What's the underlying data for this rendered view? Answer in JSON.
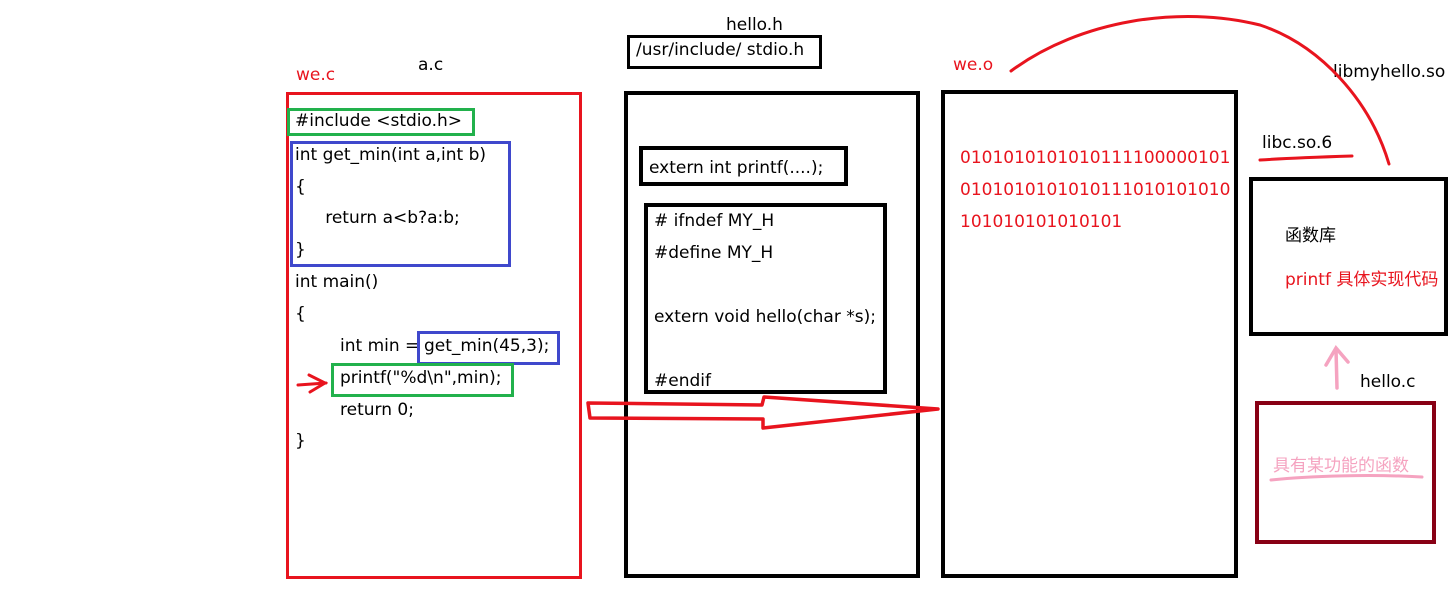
{
  "labels": {
    "we_c": "we.c",
    "a_c": "a.c",
    "hello_h": "hello.h",
    "stdio_path": "/usr/include/ stdio.h",
    "we_o": "we.o",
    "libmyhello": "libmyhello.so",
    "libc": "libc.so.6",
    "hello_c": "hello.c"
  },
  "source_code": {
    "include": "#include <stdio.h>",
    "fn_sig": "int get_min(int a,int b)",
    "fn_open": "{",
    "fn_body": "        return a<b?a:b;",
    "fn_close": "}",
    "main_sig": "int main()",
    "main_open": "{",
    "min_decl": "int min = ",
    "min_call": "get_min(45,3);",
    "printf_line": "printf(\"%d\\n\",min);",
    "return_line": "return 0;",
    "main_close": "}"
  },
  "header_file": {
    "extern_printf": "extern int printf(....);",
    "guard_lines": [
      "# ifndef MY_H",
      "#define MY_H",
      "extern void hello(char *s);",
      "#endif"
    ]
  },
  "object_file": {
    "binary_lines": [
      "0101010101010111100000101",
      "0101010101010111010101010",
      "101010101010101"
    ]
  },
  "library": {
    "title": "函数库",
    "desc": "printf 具体实现代码"
  },
  "hello_c_box": {
    "text": "具有某功能的函数"
  },
  "colors": {
    "red": "#e8141e",
    "green": "#22b14c",
    "blue": "#3f48cc",
    "black": "#000000",
    "dark_red": "#880015",
    "pink": "#f5a3c0"
  }
}
